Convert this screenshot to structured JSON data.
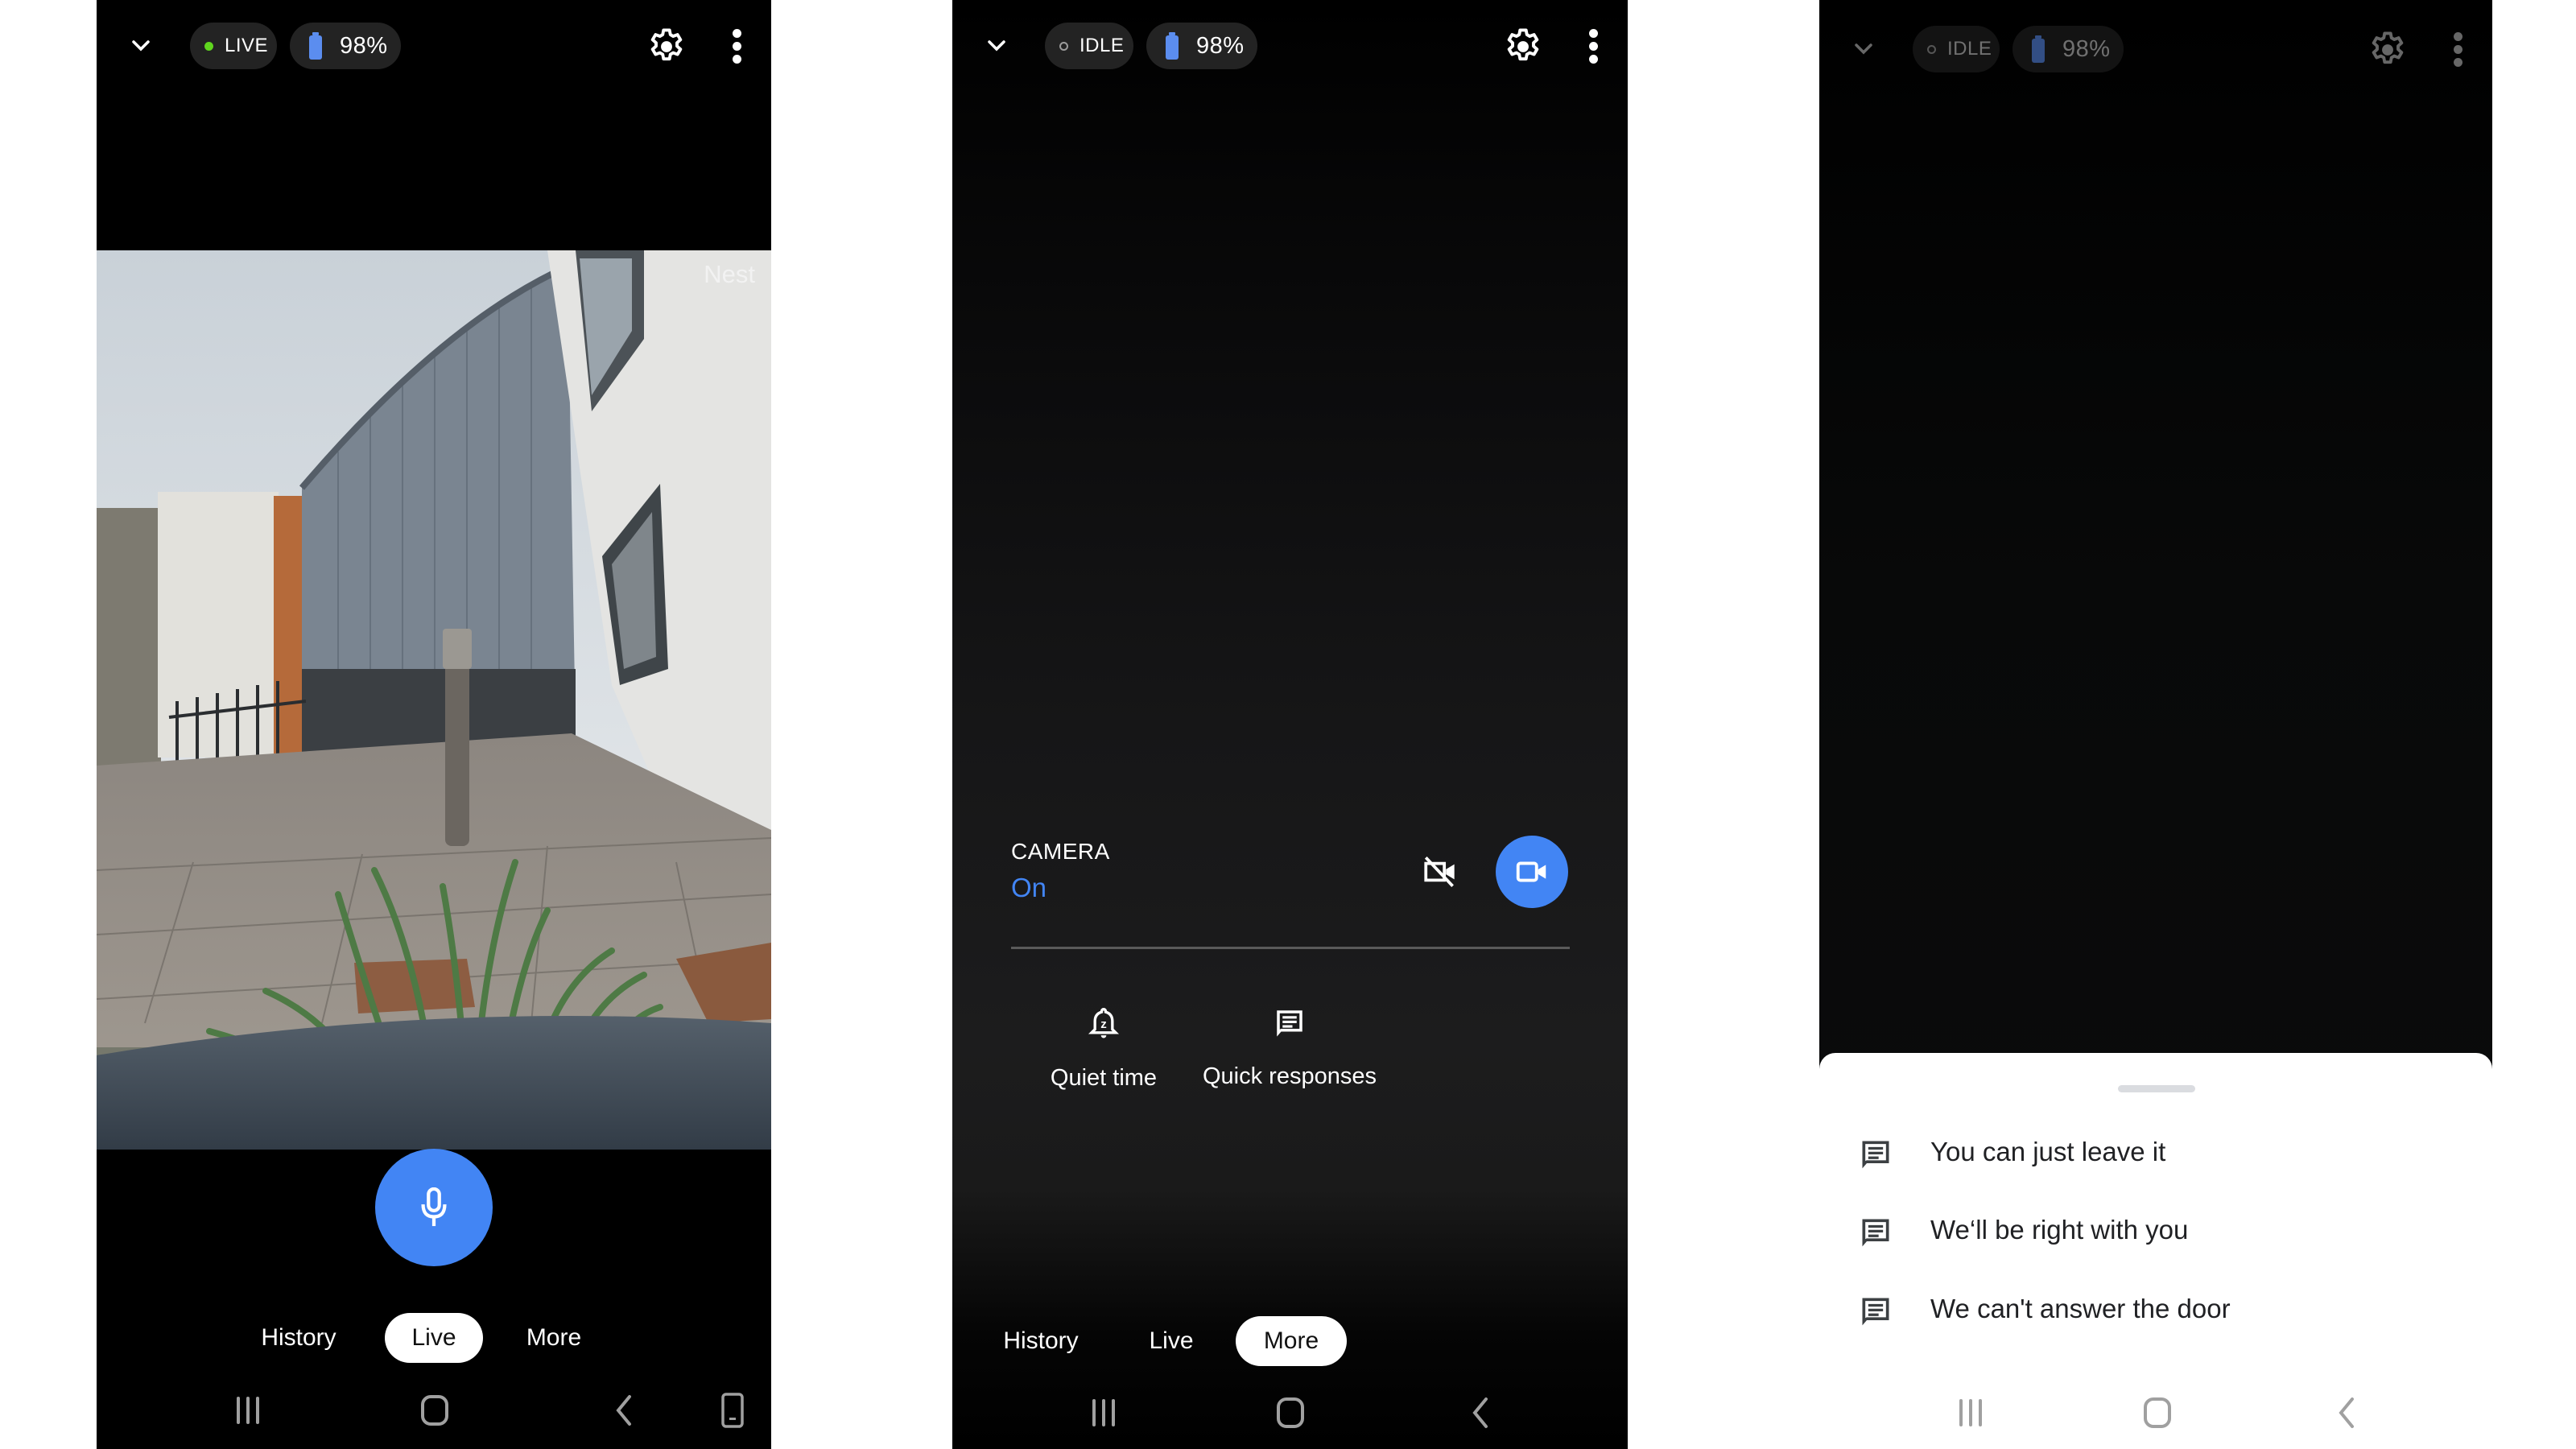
{
  "colors": {
    "accent_blue": "#4285f4",
    "battery_blue": "#5b8def",
    "live_green": "#5fd51e",
    "pill_bg": "#232323"
  },
  "phones": [
    {
      "id": "live",
      "topbar": {
        "collapse_icon": "chevron-down-icon",
        "status": "LIVE",
        "status_icon": "live-dot",
        "battery_icon": "battery-icon",
        "battery": "98%",
        "settings_icon": "gear-icon",
        "menu_icon": "more-vert-icon"
      },
      "feed": {
        "watermark": "Nest"
      },
      "mic_button": {
        "icon": "microphone-icon"
      },
      "tabs": [
        {
          "label": "History",
          "active": false
        },
        {
          "label": "Live",
          "active": true
        },
        {
          "label": "More",
          "active": false
        }
      ],
      "navbar": [
        "recent-apps-icon",
        "home-icon",
        "back-icon",
        "rotate-icon"
      ]
    },
    {
      "id": "more",
      "topbar": {
        "collapse_icon": "chevron-down-icon",
        "status": "IDLE",
        "status_icon": "idle-dot",
        "battery_icon": "battery-icon",
        "battery": "98%",
        "settings_icon": "gear-icon",
        "menu_icon": "more-vert-icon"
      },
      "camera": {
        "title": "CAMERA",
        "state": "On",
        "off_icon": "videocam-off-icon",
        "on_icon": "videocam-icon"
      },
      "actions": [
        {
          "label": "Quiet time",
          "icon": "bell-snooze-icon"
        },
        {
          "label": "Quick responses",
          "icon": "message-icon"
        }
      ],
      "tabs": [
        {
          "label": "History",
          "active": false
        },
        {
          "label": "Live",
          "active": false
        },
        {
          "label": "More",
          "active": true
        }
      ],
      "navbar": [
        "recent-apps-icon",
        "home-icon",
        "back-icon"
      ]
    },
    {
      "id": "quick-responses",
      "topbar": {
        "collapse_icon": "chevron-down-icon",
        "status": "IDLE",
        "status_icon": "idle-dot",
        "battery_icon": "battery-icon",
        "battery": "98%",
        "settings_icon": "gear-icon",
        "menu_icon": "more-vert-icon"
      },
      "quick_responses": [
        {
          "text": "You can just leave it",
          "icon": "message-icon"
        },
        {
          "text": "We‘ll be right with you",
          "icon": "message-icon"
        },
        {
          "text": "We can't answer the door",
          "icon": "message-icon"
        }
      ],
      "navbar": [
        "recent-apps-icon",
        "home-icon",
        "back-icon"
      ]
    }
  ]
}
